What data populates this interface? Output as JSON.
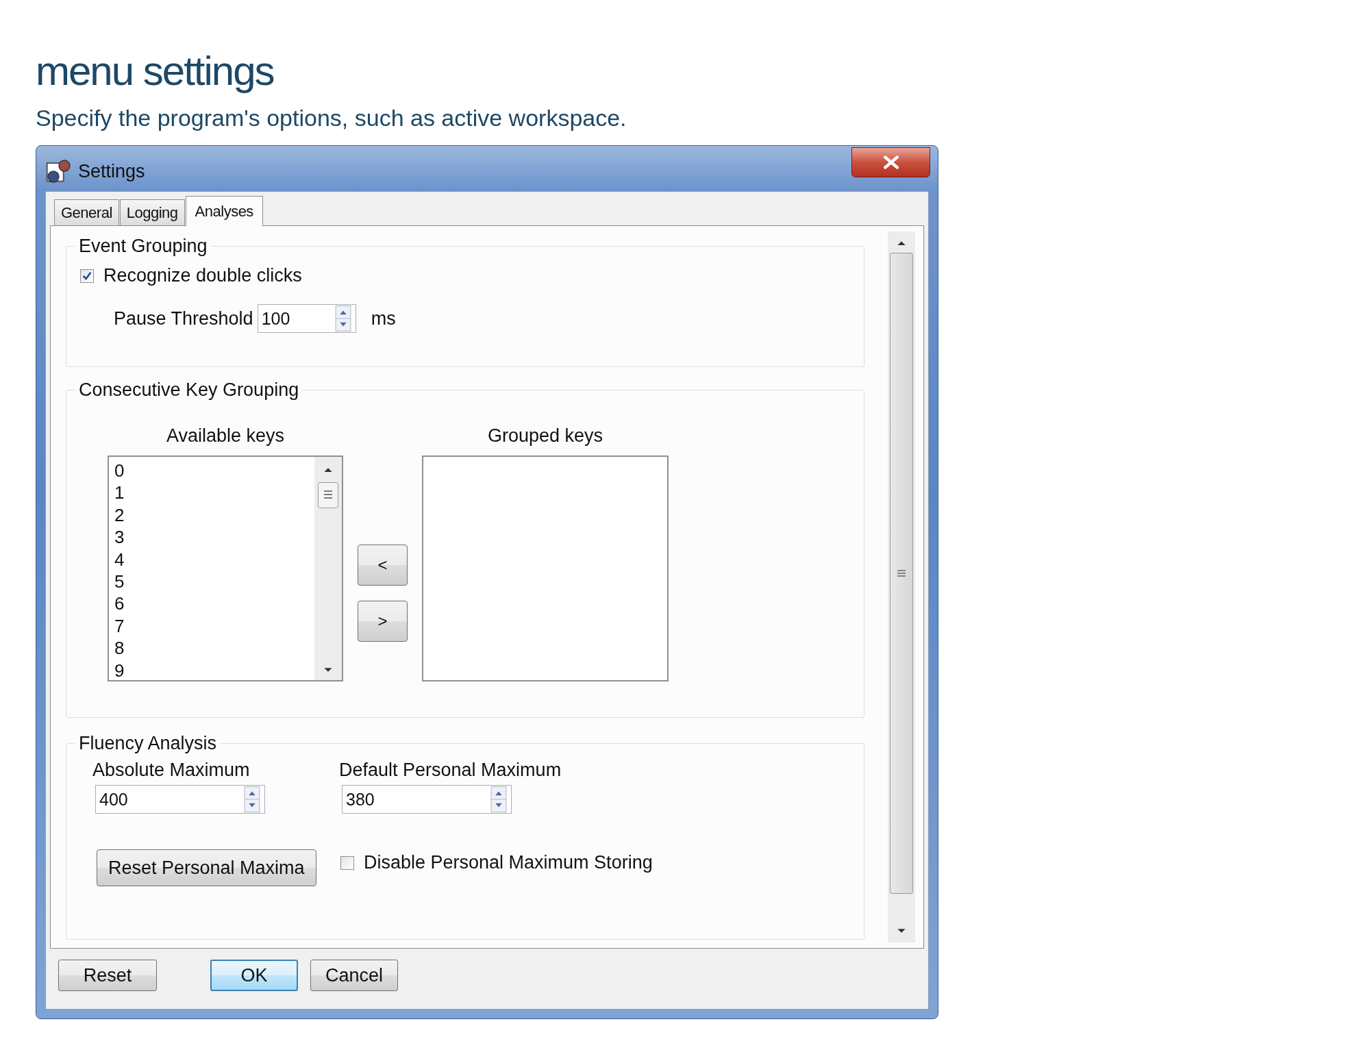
{
  "page": {
    "heading": "menu settings",
    "subtitle": "Specify the program's options, such as active workspace."
  },
  "window": {
    "title": "Settings"
  },
  "tabs": [
    {
      "label": "General",
      "selected": false
    },
    {
      "label": "Logging",
      "selected": false
    },
    {
      "label": "Analyses",
      "selected": true
    }
  ],
  "event_grouping": {
    "title": "Event Grouping",
    "double_clicks": {
      "label": "Recognize double clicks",
      "checked": true
    },
    "pause_threshold": {
      "label": "Pause Threshold",
      "value": "100",
      "unit": "ms"
    }
  },
  "key_grouping": {
    "title": "Consecutive Key Grouping",
    "available": {
      "label": "Available keys",
      "items": [
        "0",
        "1",
        "2",
        "3",
        "4",
        "5",
        "6",
        "7",
        "8",
        "9"
      ]
    },
    "move_buttons": [
      "<",
      ">"
    ],
    "grouped": {
      "label": "Grouped keys"
    }
  },
  "fluency": {
    "title": "Fluency Analysis",
    "absolute_maximum": {
      "label": "Absolute Maximum",
      "value": "400"
    },
    "default_personal_maximum": {
      "label": "Default Personal Maximum",
      "value": "380"
    },
    "reset_button": "Reset Personal Maxima",
    "disable_storing": {
      "label": "Disable Personal Maximum Storing",
      "checked": false
    }
  },
  "buttons": [
    {
      "label": "Reset",
      "default": false
    },
    {
      "label": "OK",
      "default": true
    },
    {
      "label": "Cancel",
      "default": false
    }
  ]
}
